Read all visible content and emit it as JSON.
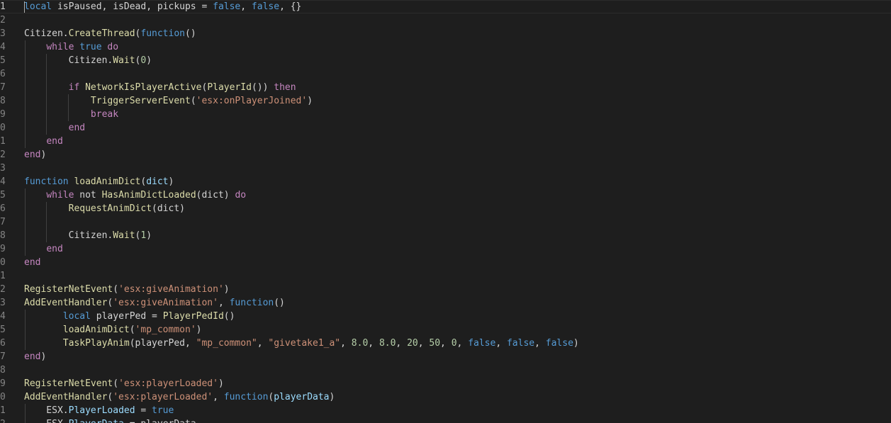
{
  "editor": {
    "language": "lua",
    "active_line": 1,
    "colors": {
      "background": "#1e1e1e",
      "line_number": "#858585",
      "keyword_control": "#c586c0",
      "keyword_storage": "#569cd6",
      "function": "#dcdcaa",
      "string": "#ce9178",
      "number": "#b5cea8",
      "variable": "#9cdcfe",
      "text": "#d4d4d4"
    },
    "lines": [
      {
        "num": "1",
        "tokens": [
          [
            "kwb",
            "local"
          ],
          [
            "plain",
            " isPaused, isDead, pickups = "
          ],
          [
            "kwb",
            "false"
          ],
          [
            "plain",
            ", "
          ],
          [
            "kwb",
            "false"
          ],
          [
            "plain",
            ", {}"
          ]
        ]
      },
      {
        "num": "2",
        "tokens": []
      },
      {
        "num": "3",
        "tokens": [
          [
            "plain",
            "Citizen."
          ],
          [
            "fn",
            "CreateThread"
          ],
          [
            "plain",
            "("
          ],
          [
            "kwb",
            "function"
          ],
          [
            "plain",
            "()"
          ]
        ]
      },
      {
        "num": "4",
        "tokens": [
          [
            "plain",
            "    "
          ],
          [
            "kw",
            "while"
          ],
          [
            "plain",
            " "
          ],
          [
            "kwb",
            "true"
          ],
          [
            "plain",
            " "
          ],
          [
            "kw",
            "do"
          ]
        ]
      },
      {
        "num": "5",
        "tokens": [
          [
            "plain",
            "        Citizen."
          ],
          [
            "fn",
            "Wait"
          ],
          [
            "plain",
            "("
          ],
          [
            "num",
            "0"
          ],
          [
            "plain",
            ")"
          ]
        ]
      },
      {
        "num": "6",
        "tokens": []
      },
      {
        "num": "7",
        "tokens": [
          [
            "plain",
            "        "
          ],
          [
            "kw",
            "if"
          ],
          [
            "plain",
            " "
          ],
          [
            "fn",
            "NetworkIsPlayerActive"
          ],
          [
            "plain",
            "("
          ],
          [
            "fn",
            "PlayerId"
          ],
          [
            "plain",
            "()) "
          ],
          [
            "kw",
            "then"
          ]
        ]
      },
      {
        "num": "8",
        "tokens": [
          [
            "plain",
            "            "
          ],
          [
            "fn",
            "TriggerServerEvent"
          ],
          [
            "plain",
            "("
          ],
          [
            "str",
            "'esx:onPlayerJoined'"
          ],
          [
            "plain",
            ")"
          ]
        ]
      },
      {
        "num": "9",
        "tokens": [
          [
            "plain",
            "            "
          ],
          [
            "kw",
            "break"
          ]
        ]
      },
      {
        "num": "0",
        "tokens": [
          [
            "plain",
            "        "
          ],
          [
            "kw",
            "end"
          ]
        ]
      },
      {
        "num": "1",
        "tokens": [
          [
            "plain",
            "    "
          ],
          [
            "kw",
            "end"
          ]
        ]
      },
      {
        "num": "2",
        "tokens": [
          [
            "kw",
            "end"
          ],
          [
            "plain",
            ")"
          ]
        ]
      },
      {
        "num": "3",
        "tokens": []
      },
      {
        "num": "4",
        "tokens": [
          [
            "kwb",
            "function"
          ],
          [
            "plain",
            " "
          ],
          [
            "fn",
            "loadAnimDict"
          ],
          [
            "plain",
            "("
          ],
          [
            "var",
            "dict"
          ],
          [
            "plain",
            ")"
          ]
        ]
      },
      {
        "num": "5",
        "tokens": [
          [
            "plain",
            "    "
          ],
          [
            "kw",
            "while"
          ],
          [
            "plain",
            " not "
          ],
          [
            "fn",
            "HasAnimDictLoaded"
          ],
          [
            "plain",
            "(dict) "
          ],
          [
            "kw",
            "do"
          ]
        ]
      },
      {
        "num": "6",
        "tokens": [
          [
            "plain",
            "        "
          ],
          [
            "fn",
            "RequestAnimDict"
          ],
          [
            "plain",
            "(dict)"
          ]
        ]
      },
      {
        "num": "7",
        "tokens": []
      },
      {
        "num": "8",
        "tokens": [
          [
            "plain",
            "        Citizen."
          ],
          [
            "fn",
            "Wait"
          ],
          [
            "plain",
            "("
          ],
          [
            "num",
            "1"
          ],
          [
            "plain",
            ")"
          ]
        ]
      },
      {
        "num": "9",
        "tokens": [
          [
            "plain",
            "    "
          ],
          [
            "kw",
            "end"
          ]
        ]
      },
      {
        "num": "0",
        "tokens": [
          [
            "kw",
            "end"
          ]
        ]
      },
      {
        "num": "1",
        "tokens": []
      },
      {
        "num": "2",
        "tokens": [
          [
            "fn",
            "RegisterNetEvent"
          ],
          [
            "plain",
            "("
          ],
          [
            "str",
            "'esx:giveAnimation'"
          ],
          [
            "plain",
            ")"
          ]
        ]
      },
      {
        "num": "3",
        "tokens": [
          [
            "fn",
            "AddEventHandler"
          ],
          [
            "plain",
            "("
          ],
          [
            "str",
            "'esx:giveAnimation'"
          ],
          [
            "plain",
            ", "
          ],
          [
            "kwb",
            "function"
          ],
          [
            "plain",
            "()"
          ]
        ]
      },
      {
        "num": "4",
        "tokens": [
          [
            "plain",
            "       "
          ],
          [
            "kwb",
            "local"
          ],
          [
            "plain",
            " playerPed = "
          ],
          [
            "fn",
            "PlayerPedId"
          ],
          [
            "plain",
            "()"
          ]
        ]
      },
      {
        "num": "5",
        "tokens": [
          [
            "plain",
            "       "
          ],
          [
            "fn",
            "loadAnimDict"
          ],
          [
            "plain",
            "("
          ],
          [
            "str",
            "'mp_common'"
          ],
          [
            "plain",
            ")"
          ]
        ]
      },
      {
        "num": "6",
        "tokens": [
          [
            "plain",
            "       "
          ],
          [
            "fn",
            "TaskPlayAnim"
          ],
          [
            "plain",
            "(playerPed, "
          ],
          [
            "str",
            "\"mp_common\""
          ],
          [
            "plain",
            ", "
          ],
          [
            "str",
            "\"givetake1_a\""
          ],
          [
            "plain",
            ", "
          ],
          [
            "num",
            "8.0"
          ],
          [
            "plain",
            ", "
          ],
          [
            "num",
            "8.0"
          ],
          [
            "plain",
            ", "
          ],
          [
            "num",
            "20"
          ],
          [
            "plain",
            ", "
          ],
          [
            "num",
            "50"
          ],
          [
            "plain",
            ", "
          ],
          [
            "num",
            "0"
          ],
          [
            "plain",
            ", "
          ],
          [
            "kwb",
            "false"
          ],
          [
            "plain",
            ", "
          ],
          [
            "kwb",
            "false"
          ],
          [
            "plain",
            ", "
          ],
          [
            "kwb",
            "false"
          ],
          [
            "plain",
            ")"
          ]
        ]
      },
      {
        "num": "7",
        "tokens": [
          [
            "kw",
            "end"
          ],
          [
            "plain",
            ")"
          ]
        ]
      },
      {
        "num": "8",
        "tokens": []
      },
      {
        "num": "9",
        "tokens": [
          [
            "fn",
            "RegisterNetEvent"
          ],
          [
            "plain",
            "("
          ],
          [
            "str",
            "'esx:playerLoaded'"
          ],
          [
            "plain",
            ")"
          ]
        ]
      },
      {
        "num": "0",
        "tokens": [
          [
            "fn",
            "AddEventHandler"
          ],
          [
            "plain",
            "("
          ],
          [
            "str",
            "'esx:playerLoaded'"
          ],
          [
            "plain",
            ", "
          ],
          [
            "kwb",
            "function"
          ],
          [
            "plain",
            "("
          ],
          [
            "var",
            "playerData"
          ],
          [
            "plain",
            ")"
          ]
        ]
      },
      {
        "num": "1",
        "tokens": [
          [
            "plain",
            "    ESX."
          ],
          [
            "var",
            "PlayerLoaded"
          ],
          [
            "plain",
            " = "
          ],
          [
            "kwb",
            "true"
          ]
        ]
      },
      {
        "num": "2",
        "tokens": [
          [
            "plain",
            "    ESX."
          ],
          [
            "var",
            "PlayerData"
          ],
          [
            "plain",
            " = playerData"
          ]
        ]
      }
    ]
  }
}
